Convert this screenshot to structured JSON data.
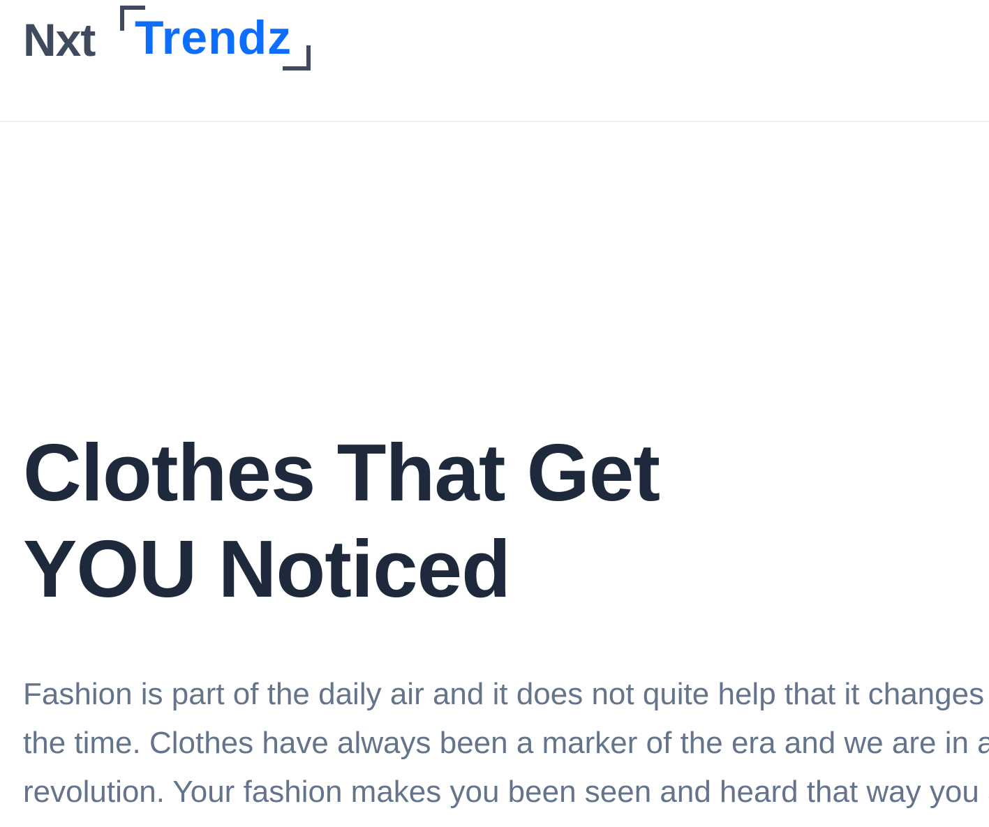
{
  "navbar": {
    "logo": {
      "nxt": "Nxt",
      "trendz": "Trendz"
    }
  },
  "hero": {
    "heading": "Clothes That Get YOU Noticed",
    "description": "Fashion is part of the daily air and it does not quite help that it changes all the time. Clothes have always been a marker of the era and we are in a revolution. Your fashion makes you been seen and heard that way you are."
  },
  "colors": {
    "brand_blue": "#0d6efd",
    "logo_dark": "#3f4a5e",
    "heading": "#1e293b",
    "body_text": "#64748b"
  }
}
